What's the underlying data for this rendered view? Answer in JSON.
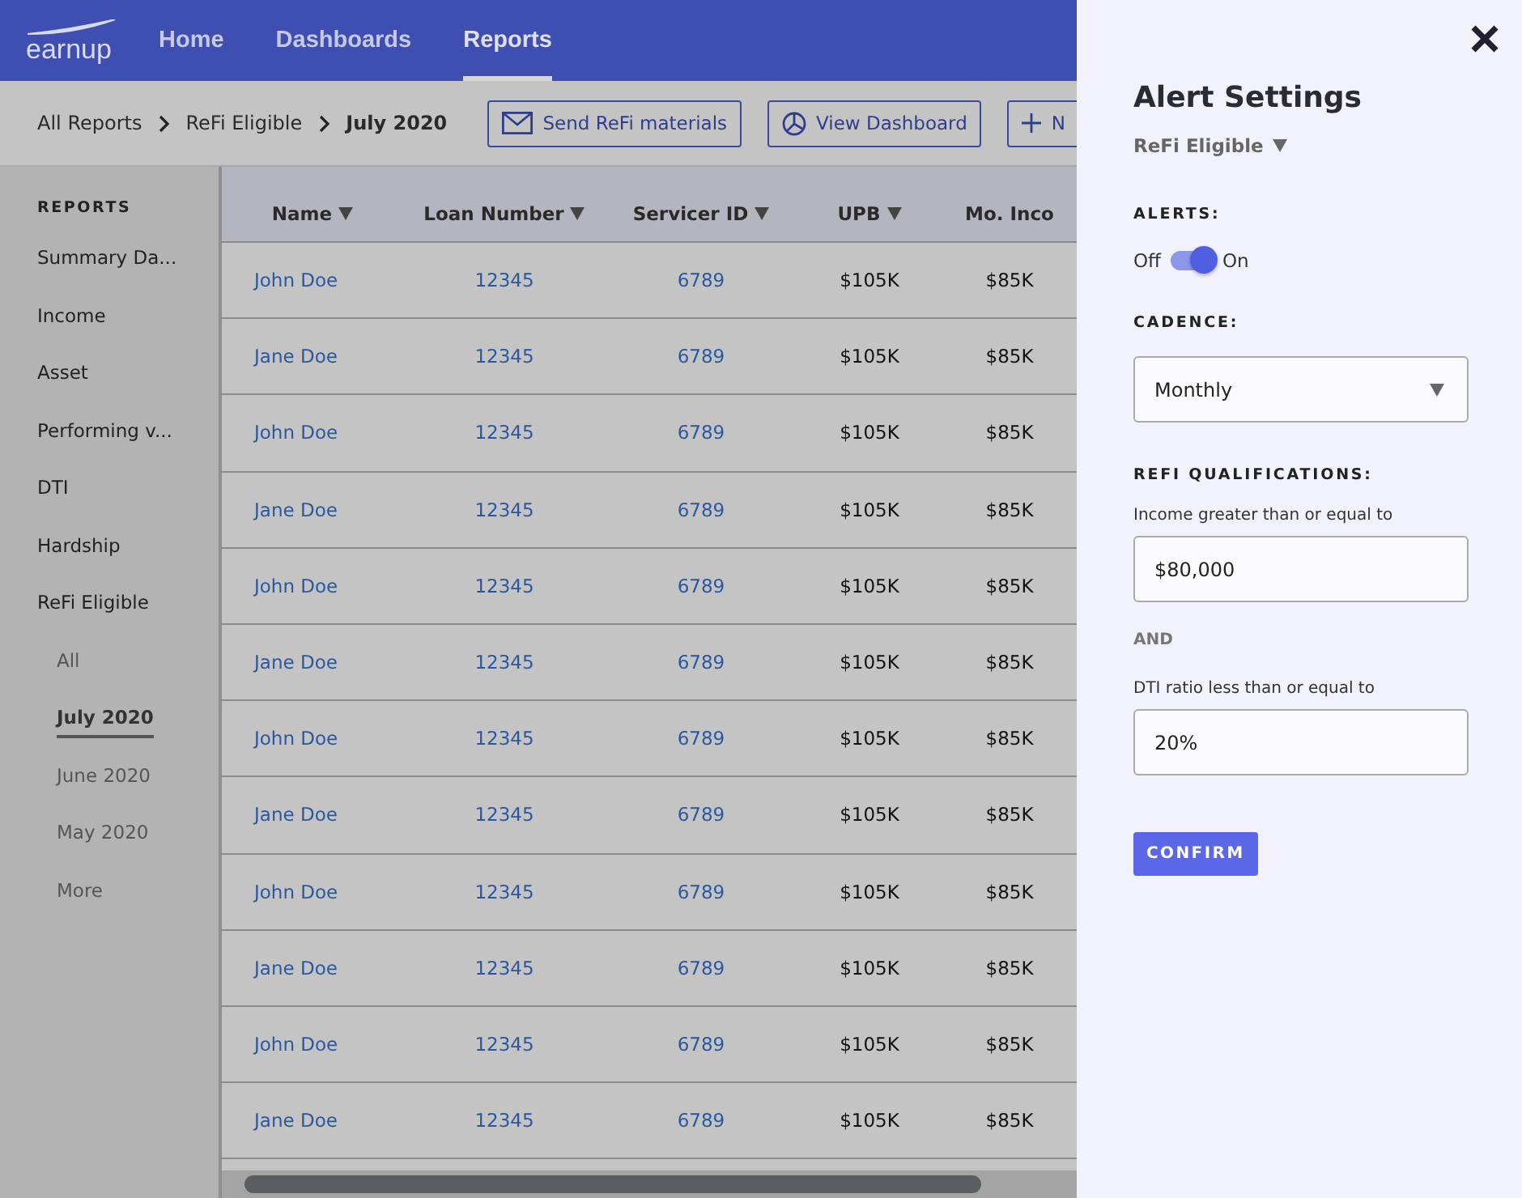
{
  "nav": {
    "logo": "earnup",
    "items": [
      {
        "label": "Home",
        "selected": false
      },
      {
        "label": "Dashboards",
        "selected": false
      },
      {
        "label": "Reports",
        "selected": true
      }
    ]
  },
  "breadcrumb": [
    {
      "label": "All Reports",
      "current": false
    },
    {
      "label": "ReFi Eligible",
      "current": false
    },
    {
      "label": "July 2020",
      "current": true
    }
  ],
  "actions": [
    {
      "kind": "mail",
      "label": "Send ReFi materials"
    },
    {
      "kind": "dashboard",
      "label": "View Dashboard"
    },
    {
      "kind": "add",
      "label": "N"
    }
  ],
  "sidebar": {
    "heading": "REPORTS",
    "items": [
      {
        "label": "Summary Da..."
      },
      {
        "label": "Income"
      },
      {
        "label": "Asset"
      },
      {
        "label": "Performing v..."
      },
      {
        "label": "DTI"
      },
      {
        "label": "Hardship"
      },
      {
        "label": "ReFi Eligible",
        "children": [
          {
            "label": "All",
            "selected": false
          },
          {
            "label": "July 2020",
            "selected": true
          },
          {
            "label": "June 2020",
            "selected": false
          },
          {
            "label": "May 2020",
            "selected": false
          },
          {
            "label": "More",
            "selected": false
          }
        ]
      }
    ]
  },
  "table": {
    "columns": [
      {
        "label": "Name",
        "sortable": true
      },
      {
        "label": "Loan Number",
        "sortable": true
      },
      {
        "label": "Servicer ID",
        "sortable": true
      },
      {
        "label": "UPB",
        "sortable": true
      },
      {
        "label": "Mo. Inco",
        "sortable": false
      }
    ],
    "rows": [
      [
        "John Doe",
        "12345",
        "6789",
        "$105K",
        "$85K"
      ],
      [
        "Jane Doe",
        "12345",
        "6789",
        "$105K",
        "$85K"
      ],
      [
        "John Doe",
        "12345",
        "6789",
        "$105K",
        "$85K"
      ],
      [
        "Jane Doe",
        "12345",
        "6789",
        "$105K",
        "$85K"
      ],
      [
        "John Doe",
        "12345",
        "6789",
        "$105K",
        "$85K"
      ],
      [
        "Jane Doe",
        "12345",
        "6789",
        "$105K",
        "$85K"
      ],
      [
        "John Doe",
        "12345",
        "6789",
        "$105K",
        "$85K"
      ],
      [
        "Jane Doe",
        "12345",
        "6789",
        "$105K",
        "$85K"
      ],
      [
        "John Doe",
        "12345",
        "6789",
        "$105K",
        "$85K"
      ],
      [
        "Jane Doe",
        "12345",
        "6789",
        "$105K",
        "$85K"
      ],
      [
        "John Doe",
        "12345",
        "6789",
        "$105K",
        "$85K"
      ],
      [
        "Jane Doe",
        "12345",
        "6789",
        "$105K",
        "$85K"
      ]
    ]
  },
  "panel": {
    "title": "Alert Settings",
    "report": "ReFi Eligible",
    "alerts_label": "ALERTS:",
    "alerts": {
      "off_label": "Off",
      "on_label": "On",
      "on": true
    },
    "cadence_label": "CADENCE:",
    "cadence": "Monthly",
    "qualifications_label": "REFI QUALIFICATIONS:",
    "income_label": "Income greater than or equal to",
    "income": "$80,000",
    "and_label": "AND",
    "dti_label": "DTI ratio less than or equal to",
    "dti": "20%",
    "confirm": "CONFIRM"
  }
}
